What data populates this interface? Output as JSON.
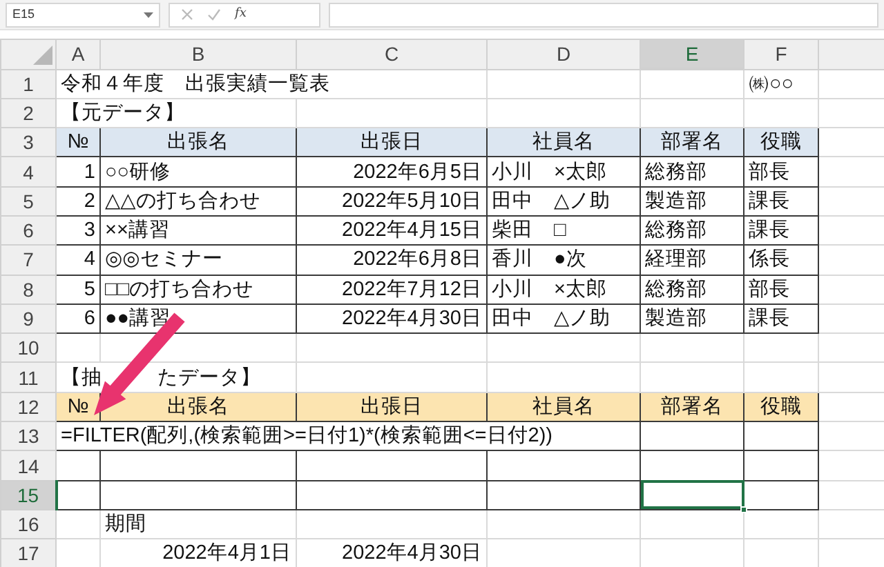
{
  "name_box": "E15",
  "formula_bar": {
    "fx": "fx"
  },
  "column_headers": [
    {
      "label": "A",
      "selected": false
    },
    {
      "label": "B",
      "selected": false
    },
    {
      "label": "C",
      "selected": false
    },
    {
      "label": "D",
      "selected": false
    },
    {
      "label": "E",
      "selected": true
    },
    {
      "label": "F",
      "selected": false
    }
  ],
  "row_headers": [
    {
      "label": "1",
      "selected": false
    },
    {
      "label": "2",
      "selected": false
    },
    {
      "label": "3",
      "selected": false
    },
    {
      "label": "4",
      "selected": false
    },
    {
      "label": "5",
      "selected": false
    },
    {
      "label": "6",
      "selected": false
    },
    {
      "label": "7",
      "selected": false
    },
    {
      "label": "8",
      "selected": false
    },
    {
      "label": "9",
      "selected": false
    },
    {
      "label": "10",
      "selected": false
    },
    {
      "label": "11",
      "selected": false
    },
    {
      "label": "12",
      "selected": false
    },
    {
      "label": "13",
      "selected": false
    },
    {
      "label": "14",
      "selected": false
    },
    {
      "label": "15",
      "selected": true
    },
    {
      "label": "16",
      "selected": false
    },
    {
      "label": "17",
      "selected": false
    }
  ],
  "title": "令和４年度　出張実績一覧表",
  "company": "㈱○○",
  "source": {
    "heading": "【元データ】",
    "columns": [
      "№",
      "出張名",
      "出張日",
      "社員名",
      "部署名",
      "役職"
    ],
    "rows": [
      [
        "1",
        "○○研修",
        "2022年6月5日",
        "小川　×太郎",
        "総務部",
        "部長"
      ],
      [
        "2",
        "△△の打ち合わせ",
        "2022年5月10日",
        "田中　△ノ助",
        "製造部",
        "課長"
      ],
      [
        "3",
        "××講習",
        "2022年4月15日",
        "柴田　□",
        "総務部",
        "課長"
      ],
      [
        "4",
        "◎◎セミナー",
        "2022年6月8日",
        "香川　●次",
        "経理部",
        "係長"
      ],
      [
        "5",
        "□□の打ち合わせ",
        "2022年7月12日",
        "小川　×太郎",
        "総務部",
        "部長"
      ],
      [
        "6",
        "●●講習",
        "2022年4月30日",
        "田中　△ノ助",
        "製造部",
        "課長"
      ]
    ]
  },
  "extracted": {
    "heading_start": "【抽",
    "heading_end": "たデータ】",
    "columns": [
      "№",
      "出張名",
      "出張日",
      "社員名",
      "部署名",
      "役職"
    ],
    "formula": "=FILTER(配列,(検索範囲>=日付1)*(検索範囲<=日付2))"
  },
  "period": {
    "label": "期間",
    "start": "2022年4月1日",
    "end": "2022年4月30日"
  }
}
